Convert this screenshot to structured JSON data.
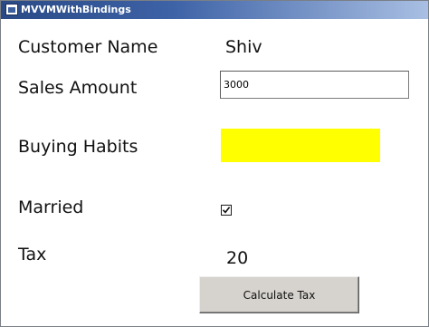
{
  "window": {
    "title": "MVVMWithBindings"
  },
  "form": {
    "customer_name_label": "Customer Name",
    "customer_name_value": "Shiv",
    "sales_amount_label": "Sales Amount",
    "sales_amount_value": "3000",
    "buying_habits_label": "Buying Habits",
    "buying_habits_color": "#ffff00",
    "married_label": "Married",
    "married_checked": true,
    "tax_label": "Tax",
    "tax_value": "20"
  },
  "actions": {
    "calculate_label": "Calculate Tax"
  },
  "icons": {
    "app": "window-icon",
    "check": "check-icon"
  }
}
